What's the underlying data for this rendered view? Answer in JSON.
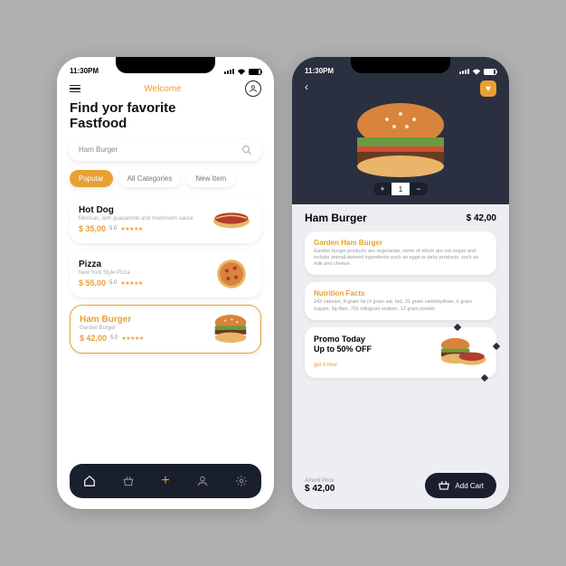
{
  "status": {
    "time": "11:30PM"
  },
  "screen1": {
    "welcome": "Welcome",
    "headline": "Find yor favorite\nFastfood",
    "search_value": "Ham Burger",
    "tabs": [
      {
        "label": "Popular",
        "active": true
      },
      {
        "label": "All Categories",
        "active": false
      },
      {
        "label": "New Item",
        "active": false
      }
    ],
    "items": [
      {
        "name": "Hot Dog",
        "desc": "Mexican, with guacamole and mushroom sauce",
        "price": "$ 35,00",
        "rating": "5.0",
        "selected": false
      },
      {
        "name": "Pizza",
        "desc": "New York Style Pizza",
        "price": "$ 55,00",
        "rating": "5.0",
        "selected": false
      },
      {
        "name": "Ham Burger",
        "desc": "Garden Burger",
        "price": "$ 42,00",
        "rating": "5.0",
        "selected": true
      }
    ]
  },
  "screen2": {
    "qty": "1",
    "title": "Ham Burger",
    "price": "$ 42,00",
    "cards": [
      {
        "title": "Garden Ham Burger",
        "text": "Garden burger products are vegetarian, some of which are not vegan and include animal-derived ingredients such as eggs or dairy products, such as milk and cheese."
      },
      {
        "title": "Nutrition Facts",
        "text": "242 calories, 8 gram fat (4 gram sat. fat), 31 gram carbohydrate, 6 gram sugars, 9g fiber, 701 milligram sodium, 12 gram protein"
      }
    ],
    "promo": {
      "line1": "Promo Today",
      "line2": "Up to 50% OFF",
      "link": "get it now"
    },
    "footer": {
      "label": "Amont Price :",
      "value": "$ 42,00",
      "button": "Add Cart"
    }
  }
}
